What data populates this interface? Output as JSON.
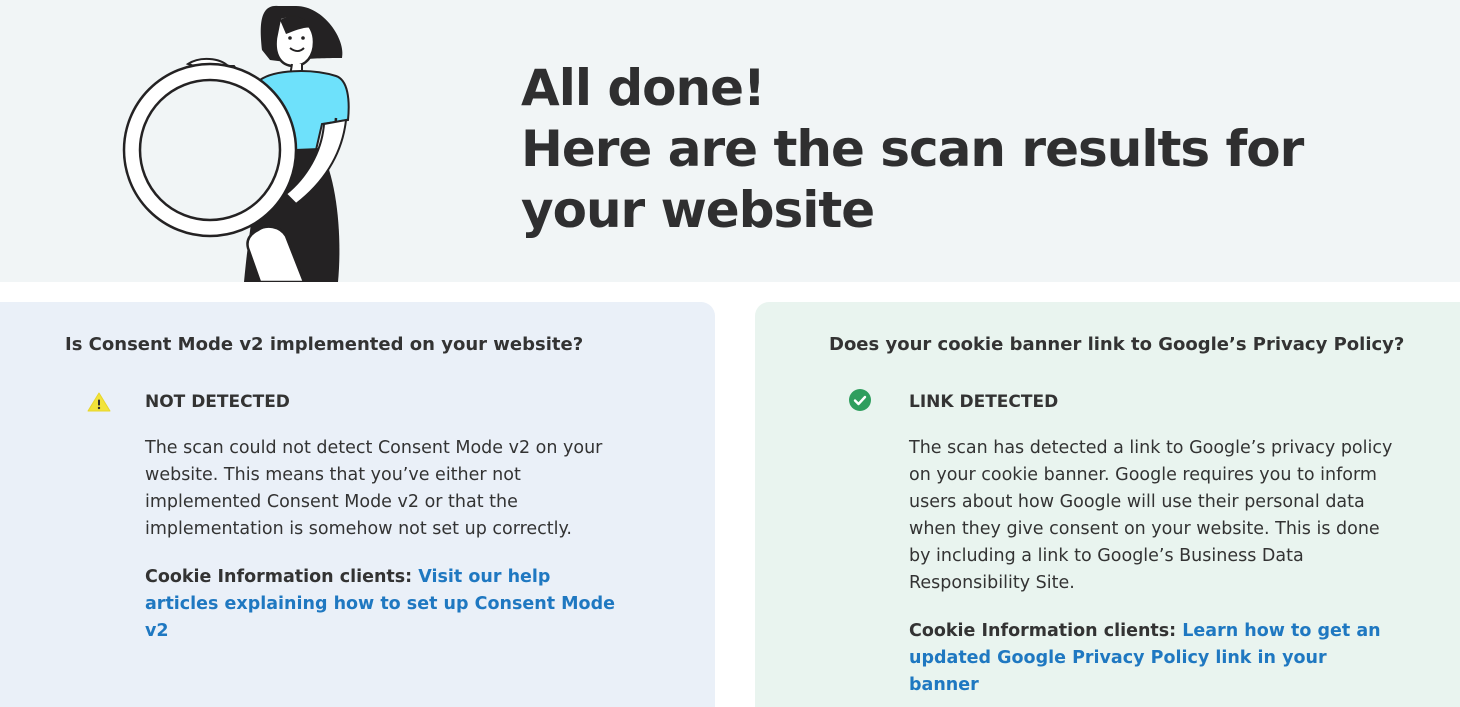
{
  "hero": {
    "title_line1": "All done!",
    "title_line2": "Here are the scan results for your website"
  },
  "cards": [
    {
      "question": "Is Consent Mode v2 implemented on your website?",
      "status_icon": "warning-icon",
      "status": "NOT DETECTED",
      "body": "The scan could not detect Consent Mode v2 on your website. This means that you’ve either not implemented Consent Mode v2 or that the implementation is somehow not set up correctly.",
      "cta_prefix": "Cookie Information clients:",
      "cta_link": "Visit our help articles explaining how to set up Consent Mode v2",
      "background": "#eaf0f8"
    },
    {
      "question": "Does your cookie banner link to Google’s Privacy Policy?",
      "status_icon": "check-circle-icon",
      "status": "LINK DETECTED",
      "body": "The scan has detected a link to Google’s privacy policy on your cookie banner. Google requires you to inform users about how Google will use their personal data when they give consent on your website. This is done by including a link to Google’s Business Data Responsibility Site.",
      "cta_prefix": "Cookie Information clients:",
      "cta_link": "Learn how to get an updated Google Privacy Policy link in your banner",
      "background": "#e9f4ef"
    }
  ],
  "colors": {
    "link": "#1f78c1",
    "warning": "#f2e33a",
    "success": "#2f9e5e",
    "accent_shirt": "#6ee1fb"
  }
}
